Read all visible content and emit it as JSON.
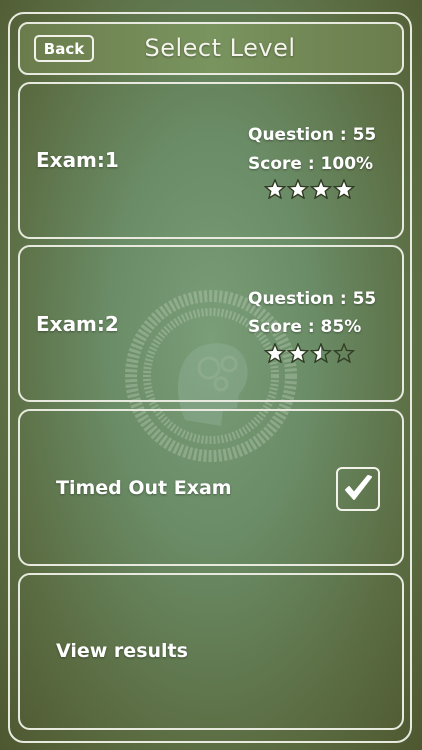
{
  "header": {
    "back_label": "Back",
    "title": "Select Level"
  },
  "exams": [
    {
      "name": "Exam:1",
      "question": "Question : 55",
      "score": "Score : 100%",
      "rating": 4,
      "max_rating": 4
    },
    {
      "name": "Exam:2",
      "question": "Question : 55",
      "score": "Score : 85%",
      "rating": 2.5,
      "max_rating": 4
    }
  ],
  "timed_out": {
    "label": "Timed Out Exam",
    "checked": true
  },
  "view_results": {
    "label": "View results"
  },
  "colors": {
    "border": "#e8eadf",
    "text": "#ffffff",
    "background": "#6a8c66"
  },
  "icons": {
    "watermark": "brain-gears-icon",
    "check": "checkmark-icon",
    "star": "star-icon"
  }
}
